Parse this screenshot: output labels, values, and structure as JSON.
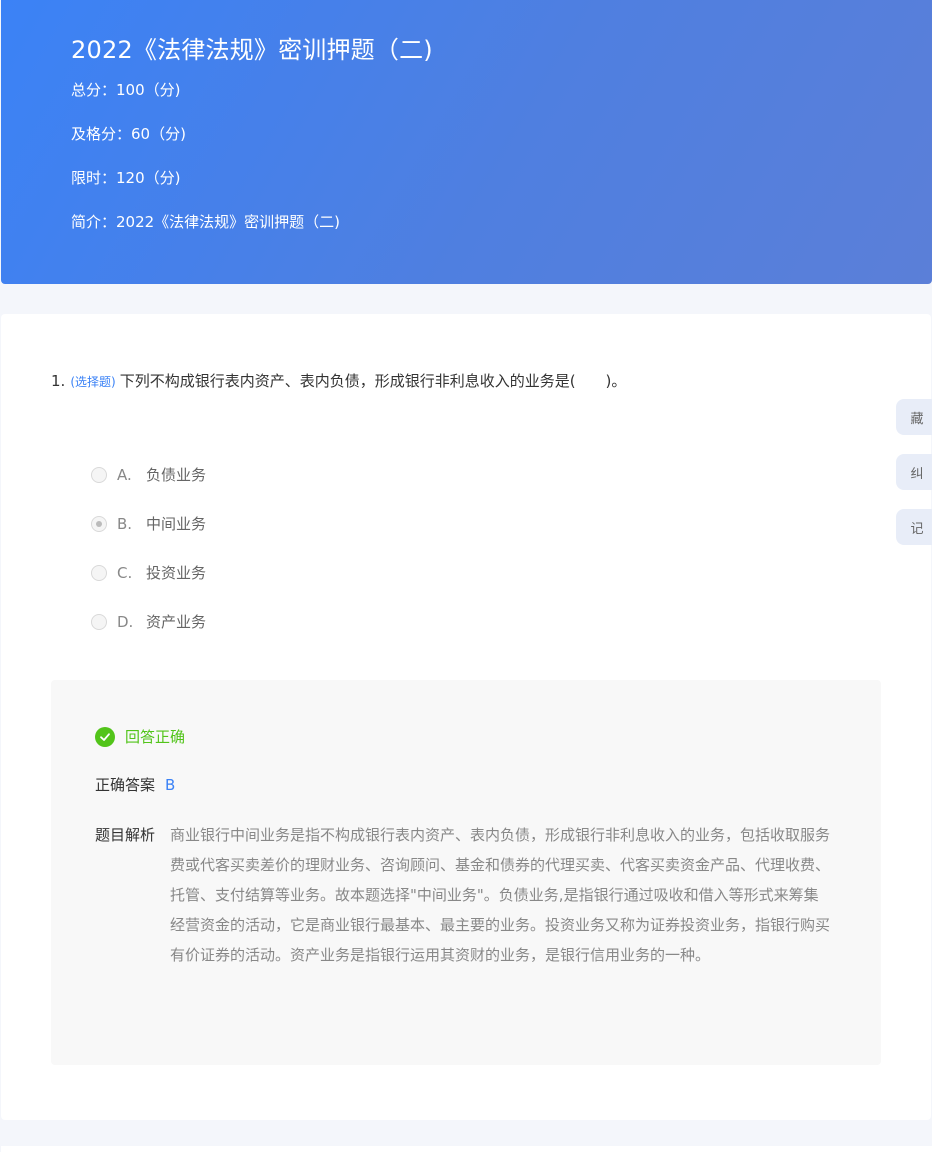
{
  "header": {
    "title": "2022《法律法规》密训押题（二)",
    "total_score": "总分：100（分)",
    "pass_score": "及格分：60（分)",
    "time_limit": "限时：120（分)",
    "intro": "简介：2022《法律法规》密训押题（二)"
  },
  "question": {
    "number": "1.",
    "type": "(选择题)",
    "text": "下列不构成银行表内资产、表内负债，形成银行非利息收入的业务是(　　)。",
    "options": [
      {
        "letter": "A.",
        "text": "负债业务",
        "selected": false
      },
      {
        "letter": "B.",
        "text": "中间业务",
        "selected": true
      },
      {
        "letter": "C.",
        "text": "投资业务",
        "selected": false
      },
      {
        "letter": "D.",
        "text": "资产业务",
        "selected": false
      }
    ]
  },
  "answer": {
    "result": "回答正确",
    "correct_label": "正确答案",
    "correct_value": "B",
    "analysis_label": "题目解析",
    "analysis_text": "商业银行中间业务是指不构成银行表内资产、表内负债，形成银行非利息收入的业务，包括收取服务费或代客买卖差价的理财业务、咨询顾问、基金和债券的代理买卖、代客买卖资金产品、代理收费、托管、支付结算等业务。故本题选择\"中间业务\"。负债业务,是指银行通过吸收和借入等形式来筹集经营资金的活动，它是商业银行最基本、最主要的业务。投资业务又称为证券投资业务，指银行购买有价证券的活动。资产业务是指银行运用其资财的业务，是银行信用业务的一种。"
  },
  "side_buttons": {
    "collect": "藏",
    "correct": "纠",
    "note": "记"
  },
  "colors": {
    "accent": "#3b82f6",
    "success": "#52c41a"
  }
}
